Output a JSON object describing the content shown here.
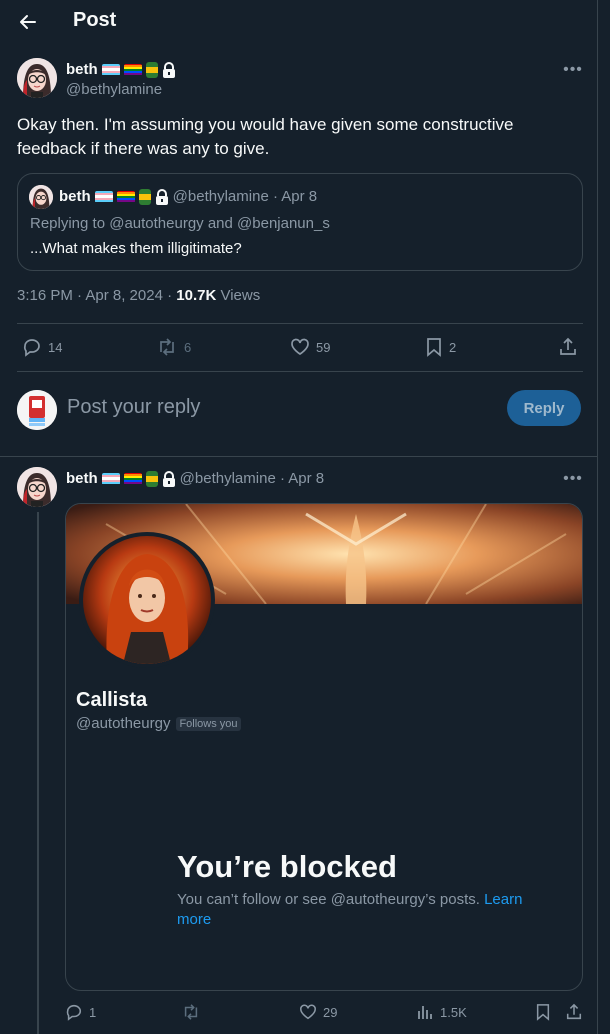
{
  "header": {
    "title": "Post"
  },
  "post": {
    "author_name": "beth",
    "author_handle": "@bethylamine",
    "text": "Okay then. I'm assuming you would have given some constructive feedback if there was any to give.",
    "time": "3:16 PM · Apr 8, 2024 · ",
    "views_count": "10.7K",
    "views_label": " Views",
    "stats": {
      "replies": "14",
      "reposts": "6",
      "likes": "59",
      "bookmarks": "2"
    }
  },
  "quote": {
    "author_name": "beth",
    "handle_date": "@bethylamine · Apr 8",
    "replying": "Replying to @autotheurgy and @benjanun_s",
    "text": "...What makes them illigitimate?"
  },
  "reply_box": {
    "placeholder": "Post your reply",
    "button": "Reply"
  },
  "reply": {
    "author_name": "beth",
    "handle_date": "@bethylamine · Apr 8",
    "card": {
      "name": "Callista",
      "handle": "@autotheurgy",
      "follows_badge": "Follows you",
      "blocked_title": "You’re blocked",
      "blocked_text": "You can’t follow or see @autotheurgy’s posts. ",
      "blocked_link": "Learn more"
    },
    "stats": {
      "replies": "1",
      "likes": "29",
      "views": "1.5K"
    }
  },
  "colors": {
    "background": "#15202b",
    "border": "#38444d",
    "muted": "#8b98a5",
    "accent": "#1d9bf0"
  }
}
